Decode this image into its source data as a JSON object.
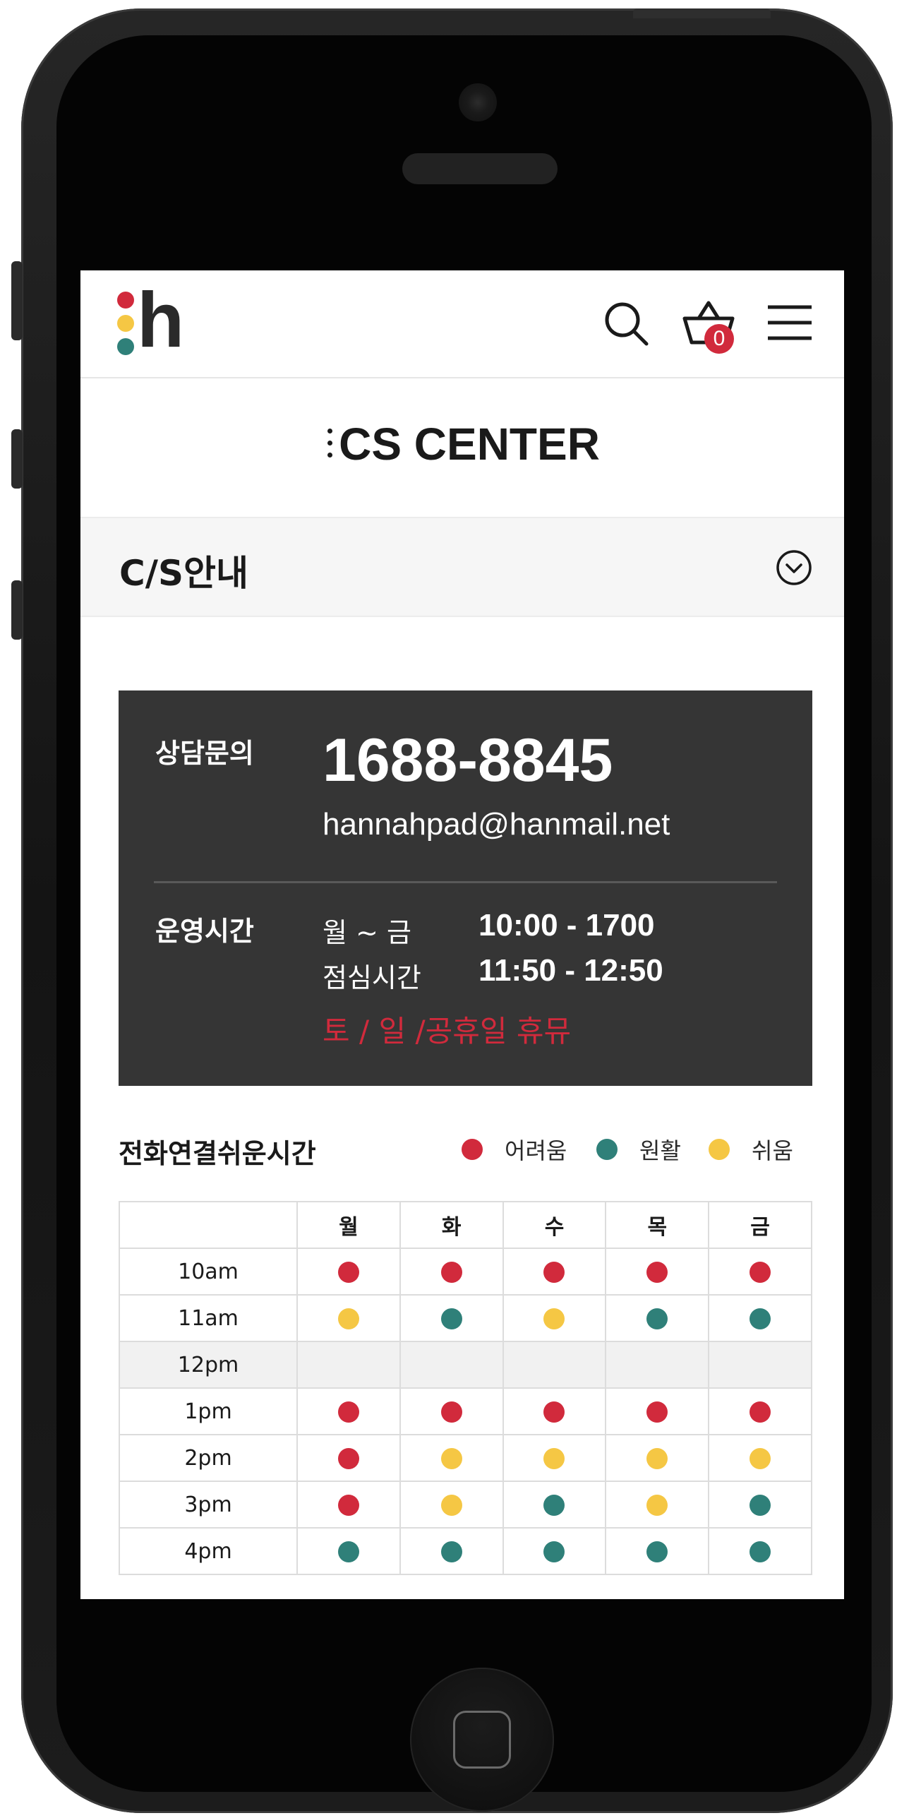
{
  "colors": {
    "hard": "#d12a3c",
    "smooth": "#2f8079",
    "easy": "#f5c744",
    "box": "#353535"
  },
  "header": {
    "logo_letter": "h",
    "logo_dot_colors": [
      "#d12a3c",
      "#f5c744",
      "#2f8079"
    ],
    "cart_count": "0"
  },
  "page_title": "CS CENTER",
  "section": {
    "title": "C/S안내"
  },
  "contact": {
    "label": "상담문의",
    "phone": "1688-8845",
    "email": "hannahpad@hanmail.net"
  },
  "hours": {
    "label": "운영시간",
    "rows": [
      {
        "day": "월   ~  금",
        "time": "10:00 - 1700"
      },
      {
        "day": "점심시간",
        "time": "11:50 - 12:50"
      }
    ],
    "holiday": "토 / 일 /공휴일 휴뮤"
  },
  "call_times": {
    "title": "전화연결쉬운시간",
    "legend": [
      {
        "label": "어려움",
        "color": "#d12a3c"
      },
      {
        "label": "원활",
        "color": "#2f8079"
      },
      {
        "label": "쉬움",
        "color": "#f5c744"
      }
    ],
    "days": [
      "월",
      "화",
      "수",
      "목",
      "금"
    ],
    "rows": [
      {
        "time": "10am",
        "status": [
          "hard",
          "hard",
          "hard",
          "hard",
          "hard"
        ]
      },
      {
        "time": "11am",
        "status": [
          "easy",
          "smooth",
          "easy",
          "smooth",
          "smooth"
        ]
      },
      {
        "time": "12pm",
        "status": [
          "",
          "",
          "",
          "",
          ""
        ]
      },
      {
        "time": "1pm",
        "status": [
          "hard",
          "hard",
          "hard",
          "hard",
          "hard"
        ]
      },
      {
        "time": "2pm",
        "status": [
          "hard",
          "easy",
          "easy",
          "easy",
          "easy"
        ]
      },
      {
        "time": "3pm",
        "status": [
          "hard",
          "easy",
          "smooth",
          "easy",
          "smooth"
        ]
      },
      {
        "time": "4pm",
        "status": [
          "smooth",
          "smooth",
          "smooth",
          "smooth",
          "smooth"
        ]
      }
    ]
  }
}
